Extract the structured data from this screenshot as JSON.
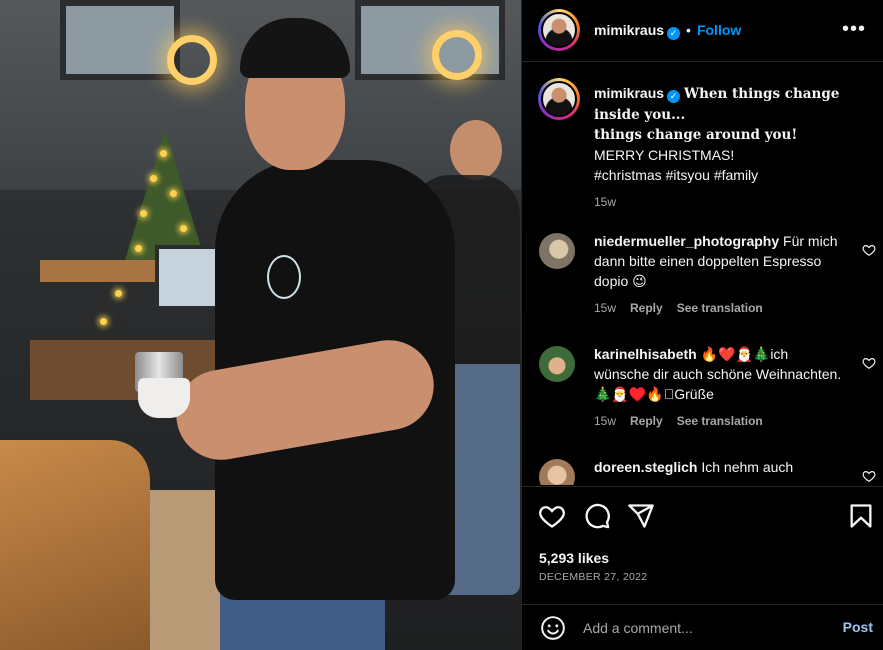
{
  "post": {
    "username": "mimikraus",
    "verified_mark": "✓",
    "follow_label": "Follow",
    "separator": "•",
    "more_label": "•••",
    "caption": {
      "line1": "When things change inside you...",
      "line2": "things change around you!",
      "line3": "MERRY CHRISTMAS!",
      "hashtags": "#christmas #itsyou #family",
      "time": "15w"
    },
    "likes": "5,293 likes",
    "date": "DECEMBER 27, 2022"
  },
  "comments": [
    {
      "username": "niedermueller_photography",
      "text": "Für mich dann bitte einen doppelten Espresso dopio 😉",
      "time": "15w",
      "reply_label": "Reply",
      "translation_label": "See translation"
    },
    {
      "username": "karinelhisabeth",
      "text": "🔥❤️🎅🎄ich wünsche dir auch schöne Weihnachten.🎄🎅♥️🔥􀀀Grüße",
      "time": "15w",
      "reply_label": "Reply",
      "translation_label": "See translation"
    },
    {
      "username": "doreen.steglich",
      "text": "Ich nehm auch",
      "time": "",
      "reply_label": "",
      "translation_label": ""
    }
  ],
  "composer": {
    "placeholder": "Add a comment...",
    "post_label": "Post"
  },
  "colors": {
    "accent": "#0095f6",
    "background": "#000000",
    "secondary_text": "#a8a8a8",
    "divider": "#262626"
  },
  "icons": [
    "heart-icon",
    "comment-icon",
    "share-icon",
    "bookmark-icon",
    "emoji-icon",
    "more-options-icon",
    "verified-badge-icon"
  ]
}
